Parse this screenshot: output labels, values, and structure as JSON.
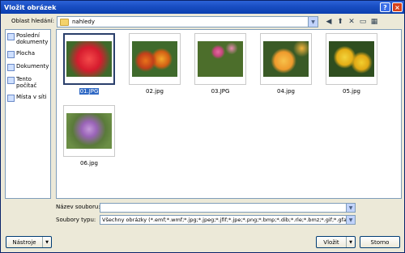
{
  "window": {
    "title": "Vložit obrázek",
    "help": "?",
    "close": "×"
  },
  "lookin": {
    "label": "Oblast hledání:",
    "value": "nahledy"
  },
  "places": [
    {
      "label": "Poslední dokumenty"
    },
    {
      "label": "Plocha"
    },
    {
      "label": "Dokumenty"
    },
    {
      "label": "Tento počítač"
    },
    {
      "label": "Místa v síti"
    }
  ],
  "files": [
    {
      "name": "01.JPG",
      "selected": true
    },
    {
      "name": "02.jpg"
    },
    {
      "name": "03.JPG"
    },
    {
      "name": "04.jpg"
    },
    {
      "name": "05.jpg"
    },
    {
      "name": "06.jpg"
    }
  ],
  "filename": {
    "label": "Název souboru:",
    "value": ""
  },
  "filetype": {
    "label": "Soubory typu:",
    "value": "Všechny obrázky (*.emf;*.wmf;*.jpg;*.jpeg;*.jfif;*.jpe;*.png;*.bmp;*.dib;*.rle;*.bmz;*.gif;*.gfa;*.emz;*.wmz;*.pcz;*.tif;*.tiff;*.eps;*.pct;*.pict;*.wpg)"
  },
  "buttons": {
    "tools": "Nástroje",
    "insert": "Vložit",
    "cancel": "Storno"
  },
  "colors": {
    "titlebar": "#1a4fc4",
    "selection": "#316ac5"
  }
}
